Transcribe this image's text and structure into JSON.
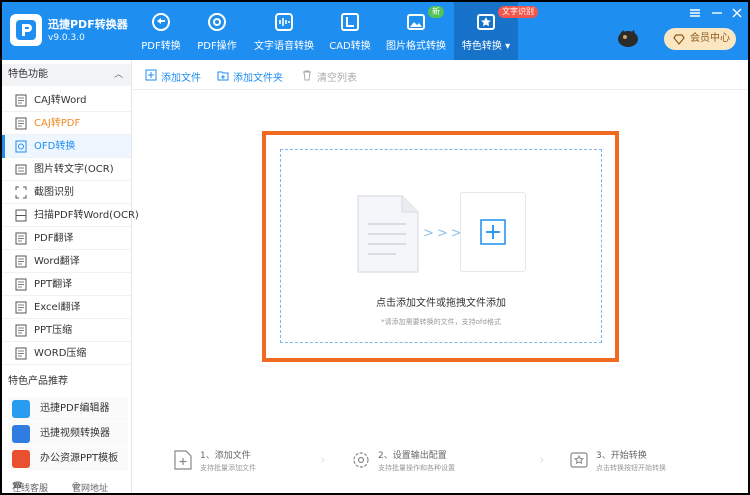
{
  "app": {
    "title": "迅捷PDF转换器",
    "version": "v9.0.3.0"
  },
  "nav": [
    {
      "label": "PDF转换",
      "icon": "convert-icon"
    },
    {
      "label": "PDF操作",
      "icon": "gear-icon"
    },
    {
      "label": "文字语音转换",
      "icon": "audio-wave-icon"
    },
    {
      "label": "CAD转换",
      "icon": "cad-icon"
    },
    {
      "label": "图片格式转换",
      "icon": "image-icon",
      "badge": "新"
    },
    {
      "label": "特色转换",
      "icon": "star-icon",
      "badge": "文字识别",
      "active": true
    }
  ],
  "vip_label": "会员中心",
  "sidebar": {
    "section1": "特色功能",
    "items": [
      {
        "label": "CAJ转Word",
        "icon": "caj-icon",
        "state": "normal"
      },
      {
        "label": "CAJ转PDF",
        "icon": "caj-pdf-icon",
        "state": "orange"
      },
      {
        "label": "OFD转换",
        "icon": "ofd-icon",
        "state": "active"
      },
      {
        "label": "图片转文字(OCR)",
        "icon": "ocr-icon",
        "state": "normal"
      },
      {
        "label": "截图识别",
        "icon": "screenshot-icon",
        "state": "normal"
      },
      {
        "label": "扫描PDF转Word(OCR)",
        "icon": "scan-icon",
        "state": "normal"
      },
      {
        "label": "PDF翻译",
        "icon": "doc-icon",
        "state": "normal"
      },
      {
        "label": "Word翻译",
        "icon": "doc-icon",
        "state": "normal"
      },
      {
        "label": "PPT翻译",
        "icon": "doc-icon",
        "state": "normal"
      },
      {
        "label": "Excel翻译",
        "icon": "doc-icon",
        "state": "normal"
      },
      {
        "label": "PPT压缩",
        "icon": "doc-icon",
        "state": "normal"
      },
      {
        "label": "WORD压缩",
        "icon": "doc-icon",
        "state": "normal"
      }
    ],
    "section2": "特色产品推荐",
    "products": [
      {
        "label": "迅捷PDF编辑器",
        "color": "#2a9cf0"
      },
      {
        "label": "迅捷视频转换器",
        "color": "#2f7de1"
      },
      {
        "label": "办公资源PPT模板",
        "color": "#e8502f"
      }
    ],
    "footer": {
      "service": "在线客服",
      "website": "官网地址"
    }
  },
  "toolbar": {
    "add_file": "添加文件",
    "add_folder": "添加文件夹",
    "clear_list": "清空列表"
  },
  "drop": {
    "main": "点击添加文件或拖拽文件添加",
    "hint": "*请添加需要转换的文件，支持ofd格式"
  },
  "steps": [
    {
      "title": "1、添加文件",
      "desc": "支持批量添加文件"
    },
    {
      "title": "2、设置输出配置",
      "desc": "支持批量操作和各种设置"
    },
    {
      "title": "3、开始转换",
      "desc": "点击转换按钮开始转换"
    }
  ],
  "colors": {
    "brand": "#1f8ef1",
    "highlight": "#f06a21",
    "accent_orange": "#f08a24"
  }
}
